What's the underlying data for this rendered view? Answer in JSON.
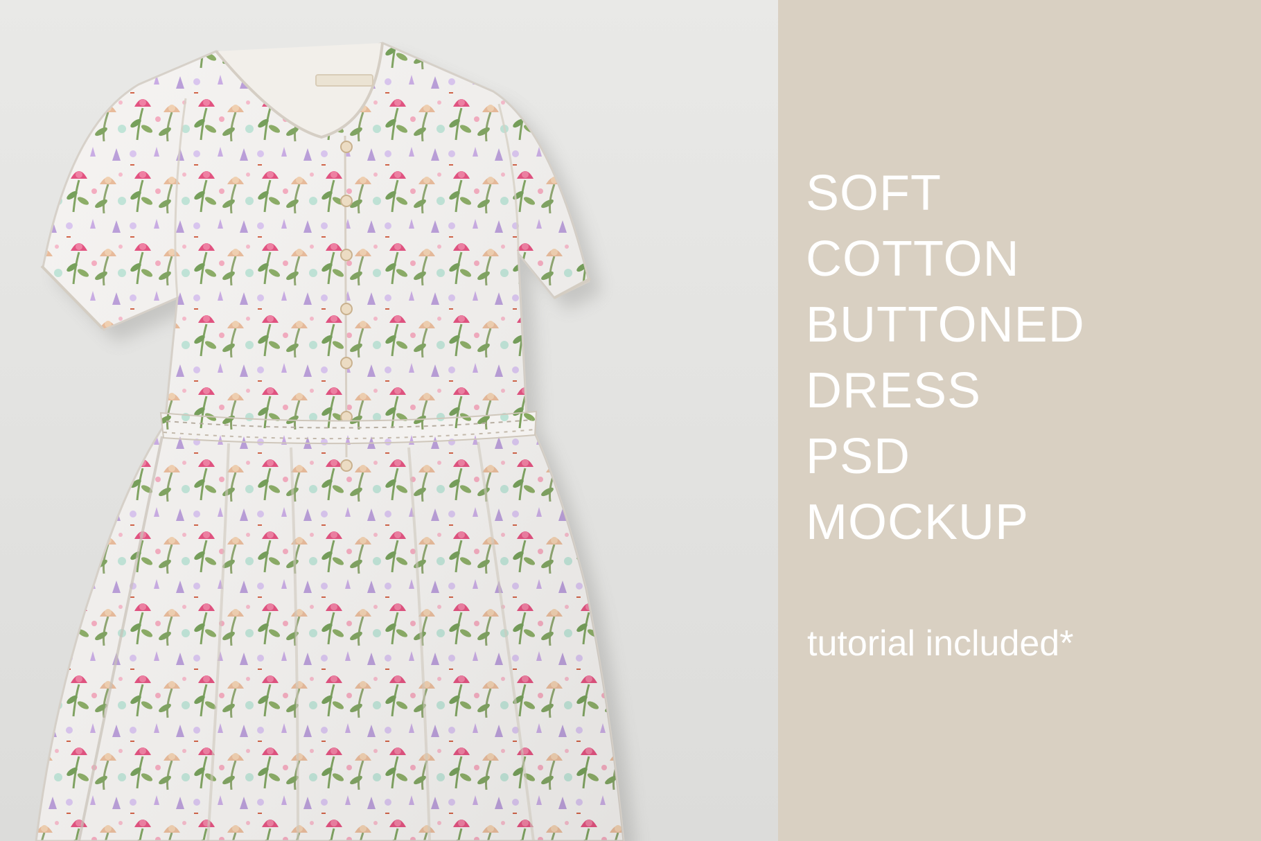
{
  "image": {
    "subject": "dress-icon",
    "colors": {
      "background": "#e6e6e4",
      "panel": "#d9d0c2",
      "text": "#ffffff",
      "fabric": "#f3f1ef",
      "pink": "#e2497a",
      "peach": "#e8b896",
      "lilac": "#b79ad8",
      "leaf": "#7aa05a"
    }
  },
  "headline": {
    "lines": [
      "SOFT",
      "COTTON",
      "BUTTONED",
      "DRESS",
      "PSD",
      "MOCKUP"
    ]
  },
  "subline": "tutorial included*"
}
